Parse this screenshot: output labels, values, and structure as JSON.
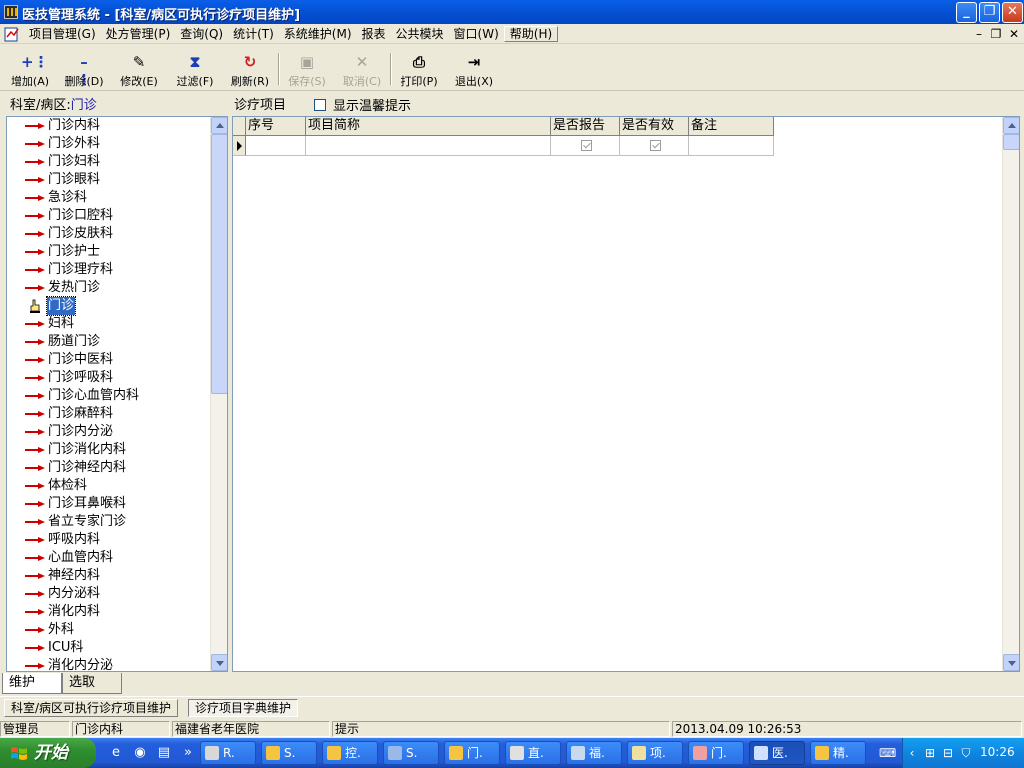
{
  "window": {
    "title": "医技管理系统 - [科室/病区可执行诊疗项目维护]"
  },
  "menu": [
    "项目管理(G)",
    "处方管理(P)",
    "查询(Q)",
    "统计(T)",
    "系统维护(M)",
    "报表",
    "公共模块",
    "窗口(W)",
    "帮助(H)"
  ],
  "toolbar": {
    "add": "增加(A)",
    "delete": "删除(D)",
    "edit": "修改(E)",
    "filter": "过滤(F)",
    "refresh": "刷新(R)",
    "save": "保存(S)",
    "cancel": "取消(C)",
    "print": "打印(P)",
    "exit": "退出(X)"
  },
  "dept": {
    "label": "科室/病区:",
    "value": "门诊"
  },
  "items_panel": {
    "label": "诊疗项目",
    "checkbox_label": "显示温馨提示"
  },
  "tree": {
    "items": [
      "门诊内科",
      "门诊外科",
      "门诊妇科",
      "门诊眼科",
      "急诊科",
      "门诊口腔科",
      "门诊皮肤科",
      "门诊护士",
      "门诊理疗科",
      "发热门诊",
      "门诊",
      "妇科",
      "肠道门诊",
      "门诊中医科",
      "门诊呼吸科",
      "门诊心血管内科",
      "门诊麻醉科",
      "门诊内分泌",
      "门诊消化内科",
      "门诊神经内科",
      "体检科",
      "门诊耳鼻喉科",
      "省立专家门诊",
      "呼吸内科",
      "心血管内科",
      "神经内科",
      "内分泌科",
      "消化内科",
      "外科",
      "ICU科",
      "消化内分泌"
    ],
    "selected_index": 10
  },
  "grid": {
    "columns": [
      "序号",
      "项目简称",
      "是否报告",
      "是否有效",
      "备注"
    ]
  },
  "bottom_tabs": {
    "maintain": "维护",
    "select": "选取"
  },
  "doc_tabs": {
    "tab1": "科室/病区可执行诊疗项目维护",
    "tab2": "诊疗项目字典维护"
  },
  "status": {
    "user": "管理员",
    "dept": "门诊内科",
    "hospital": "福建省老年医院",
    "hint": "提示",
    "datetime": "2013.04.09 10:26:53"
  },
  "taskbar": {
    "start": "开始",
    "buttons": [
      "R.",
      "S.",
      "控.",
      "S.",
      "门.",
      "直.",
      "福.",
      "项.",
      "门.",
      "医.",
      "精."
    ],
    "clock": "10:26"
  },
  "colors": {
    "titlebar": "#0553d6",
    "tree_arrow": "#cc0000",
    "selection": "#316ac5",
    "taskbar": "#245edb",
    "start": "#2f8f2f"
  }
}
